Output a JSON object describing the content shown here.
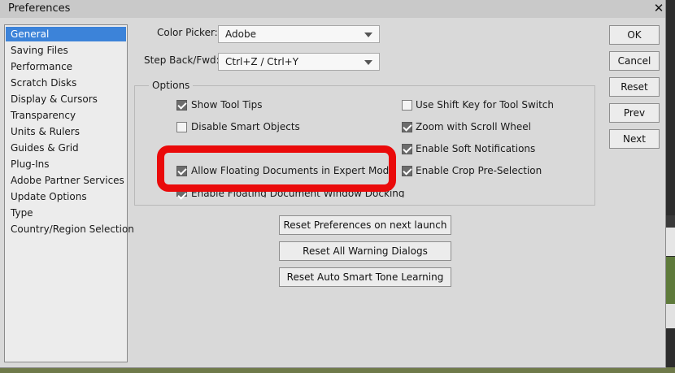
{
  "window": {
    "title": "Preferences",
    "close_icon": "close-icon"
  },
  "sidebar": {
    "items": [
      {
        "label": "General",
        "selected": true
      },
      {
        "label": "Saving Files"
      },
      {
        "label": "Performance"
      },
      {
        "label": "Scratch Disks"
      },
      {
        "label": "Display & Cursors"
      },
      {
        "label": "Transparency"
      },
      {
        "label": "Units & Rulers"
      },
      {
        "label": "Guides & Grid"
      },
      {
        "label": "Plug-Ins"
      },
      {
        "label": "Adobe Partner Services"
      },
      {
        "label": "Update Options"
      },
      {
        "label": "Type"
      },
      {
        "label": "Country/Region Selection"
      }
    ]
  },
  "color_picker": {
    "label": "Color Picker:",
    "value": "Adobe"
  },
  "step_back": {
    "label": "Step Back/Fwd:",
    "value": "Ctrl+Z / Ctrl+Y"
  },
  "options": {
    "title": "Options",
    "show_tool_tips": {
      "label": "Show Tool Tips",
      "checked": true
    },
    "disable_smart_objects": {
      "label": "Disable Smart Objects",
      "checked": false
    },
    "allow_floating": {
      "label": "Allow Floating Documents in Expert Mode",
      "checked": true
    },
    "enable_floating_docking": {
      "label": "Enable Floating Document Window Docking",
      "checked": true
    },
    "use_shift_key": {
      "label": "Use Shift Key for Tool Switch",
      "checked": false
    },
    "zoom_scroll": {
      "label": "Zoom with Scroll Wheel",
      "checked": true
    },
    "soft_notifications": {
      "label": "Enable Soft Notifications",
      "checked": true
    },
    "crop_preselection": {
      "label": "Enable Crop Pre-Selection",
      "checked": true
    }
  },
  "buttons": {
    "ok": "OK",
    "cancel": "Cancel",
    "reset": "Reset",
    "prev": "Prev",
    "next": "Next",
    "reset_prefs": "Reset Preferences on next launch",
    "reset_warnings": "Reset All Warning Dialogs",
    "reset_smart_tone": "Reset Auto Smart Tone Learning"
  },
  "colors": {
    "highlight": "#ea0a0a",
    "selection": "#3c83d9"
  }
}
